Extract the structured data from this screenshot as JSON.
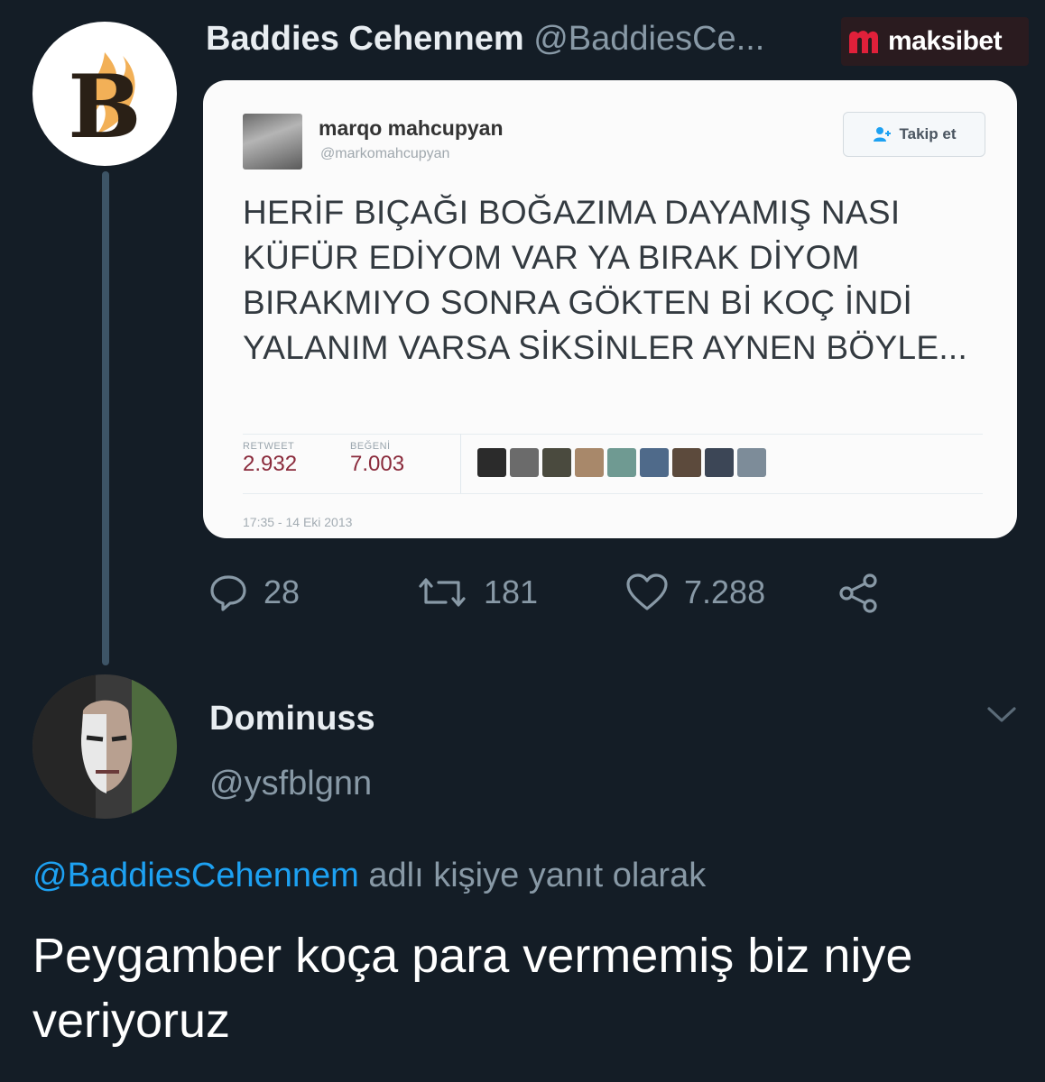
{
  "brand": {
    "name": "maksibet",
    "accent": "#e0203a"
  },
  "retweeted_tweet": {
    "author_name": "Baddies Cehennem",
    "author_handle": "@BaddiesCe...",
    "avatar_letter": "B",
    "embedded": {
      "author_name": "marqo mahcupyan",
      "author_handle": "@markomahcupyan",
      "follow_label": "Takip et",
      "text": "HERİF BIÇAĞI BOĞAZIMA DAYAMIŞ NASI KÜFÜR EDİYOM VAR YA BIRAK DİYOM BIRAKMIYO SONRA GÖKTEN Bİ KOÇ İNDİ YALANIM VARSA SİKSİNLER AYNEN BÖYLE...",
      "retweet_label": "RETWEET",
      "retweet_count": "2.932",
      "like_label": "BEĞENİ",
      "like_count": "7.003",
      "timestamp": "17:35 - 14 Eki 2013"
    },
    "actions": {
      "replies": "28",
      "retweets": "181",
      "likes": "7.288"
    }
  },
  "reply_tweet": {
    "author_name": "Dominuss",
    "author_handle": "@ysfblgnn",
    "reply_to_handle": "@BaddiesCehennem",
    "reply_to_suffix": " adlı kişiye yanıt olarak",
    "text": "Peygamber koça para vermemiş biz niye veriyoruz"
  },
  "colors": {
    "background": "#141d26",
    "muted": "#8899a6",
    "link": "#1da1f2"
  }
}
